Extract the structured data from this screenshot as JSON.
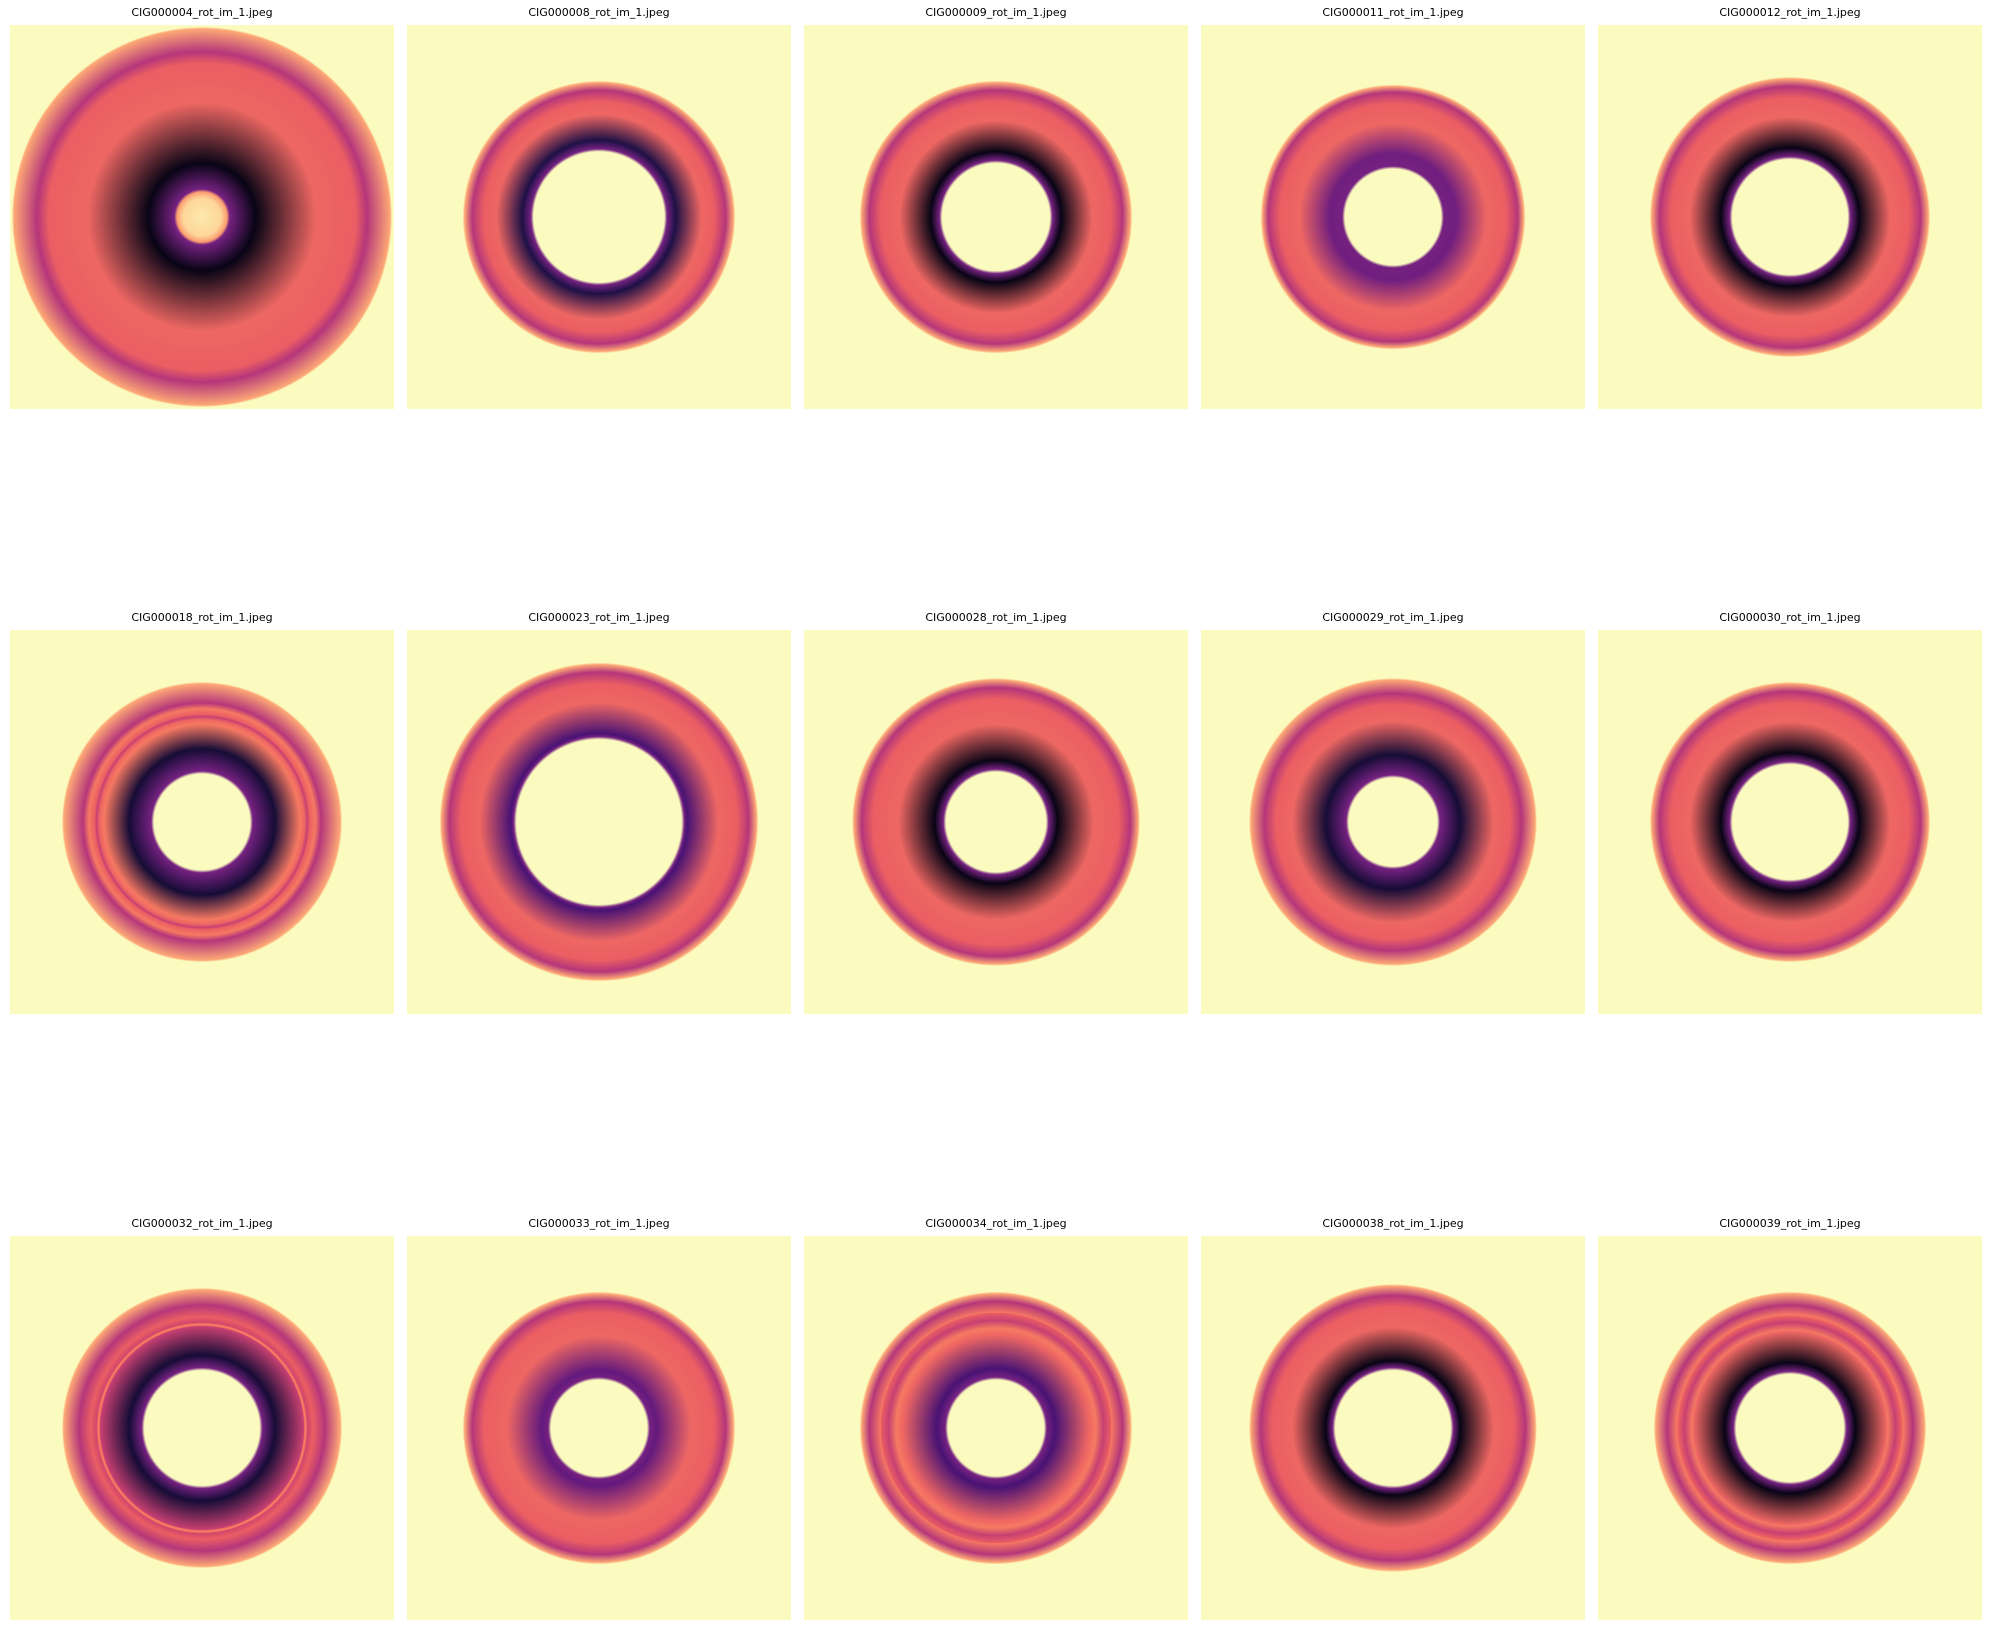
{
  "colors": {
    "background": "#fbfbbf",
    "colormap": "magma"
  },
  "panels": [
    {
      "title": "CIG000004_rot_im_1.jpeg",
      "hole": 0.13,
      "dark": 0.28,
      "edge": 0.98,
      "outer_blur": 0.12,
      "darkness": 1.0,
      "inner_fill": "light-glow"
    },
    {
      "title": "CIG000008_rot_im_1.jpeg",
      "hole": 0.34,
      "dark": 0.4,
      "edge": 0.7,
      "outer_blur": 0.04,
      "darkness": 0.85
    },
    {
      "title": "CIG000009_rot_im_1.jpeg",
      "hole": 0.28,
      "dark": 0.34,
      "edge": 0.7,
      "outer_blur": 0.04,
      "darkness": 1.0
    },
    {
      "title": "CIG000011_rot_im_1.jpeg",
      "hole": 0.25,
      "dark": 0.33,
      "edge": 0.68,
      "outer_blur": 0.03,
      "darkness": 0.55
    },
    {
      "title": "CIG000012_rot_im_1.jpeg",
      "hole": 0.3,
      "dark": 0.36,
      "edge": 0.72,
      "outer_blur": 0.04,
      "darkness": 1.0
    },
    {
      "title": "CIG000018_rot_im_1.jpeg",
      "hole": 0.25,
      "dark": 0.38,
      "edge": 0.72,
      "outer_blur": 0.1,
      "darkness": 0.9,
      "extra_ring": 0.55
    },
    {
      "title": "CIG000023_rot_im_1.jpeg",
      "hole": 0.43,
      "dark": 0.46,
      "edge": 0.82,
      "outer_blur": 0.04,
      "darkness": 0.7
    },
    {
      "title": "CIG000028_rot_im_1.jpeg",
      "hole": 0.26,
      "dark": 0.32,
      "edge": 0.74,
      "outer_blur": 0.04,
      "darkness": 1.0
    },
    {
      "title": "CIG000029_rot_im_1.jpeg",
      "hole": 0.23,
      "dark": 0.35,
      "edge": 0.74,
      "outer_blur": 0.07,
      "darkness": 0.9
    },
    {
      "title": "CIG000030_rot_im_1.jpeg",
      "hole": 0.3,
      "dark": 0.36,
      "edge": 0.72,
      "outer_blur": 0.04,
      "darkness": 1.0
    },
    {
      "title": "CIG000032_rot_im_1.jpeg",
      "hole": 0.3,
      "dark": 0.38,
      "edge": 0.72,
      "outer_blur": 0.08,
      "darkness": 0.9,
      "thin_ring": 0.54
    },
    {
      "title": "CIG000033_rot_im_1.jpeg",
      "hole": 0.25,
      "dark": 0.3,
      "edge": 0.7,
      "outer_blur": 0.04,
      "darkness": 0.6
    },
    {
      "title": "CIG000034_rot_im_1.jpeg",
      "hole": 0.25,
      "dark": 0.31,
      "edge": 0.7,
      "outer_blur": 0.04,
      "darkness": 0.7,
      "extra_ring": 0.56
    },
    {
      "title": "CIG000038_rot_im_1.jpeg",
      "hole": 0.3,
      "dark": 0.35,
      "edge": 0.74,
      "outer_blur": 0.05,
      "darkness": 1.0
    },
    {
      "title": "CIG000039_rot_im_1.jpeg",
      "hole": 0.28,
      "dark": 0.34,
      "edge": 0.7,
      "outer_blur": 0.06,
      "darkness": 1.0,
      "extra_ring": 0.55
    }
  ]
}
